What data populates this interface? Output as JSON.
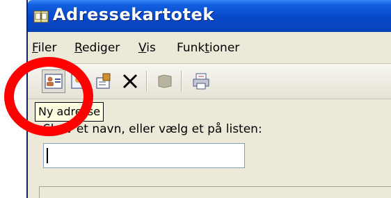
{
  "window": {
    "title": "Adressekartotek"
  },
  "menu": {
    "items": [
      {
        "name": "menu-filer",
        "underlined": "F",
        "rest": "iler"
      },
      {
        "name": "menu-rediger",
        "underlined": "R",
        "rest": "ediger"
      },
      {
        "name": "menu-vis",
        "underlined": "V",
        "rest": "is"
      },
      {
        "name": "menu-funktioner",
        "pre": "Funk",
        "underlined": "t",
        "rest": "ioner"
      }
    ]
  },
  "toolbar": {
    "buttons": [
      "new-contact",
      "new-group",
      "properties",
      "delete",
      "find-people",
      "print"
    ],
    "tooltip": "Ny adresse"
  },
  "form": {
    "label_first": "S",
    "label_rest": "kriv et navn, eller vælg et på listen:",
    "input_value": "",
    "input_placeholder": ""
  },
  "annotation": {
    "circle_color": "#ff0000"
  }
}
